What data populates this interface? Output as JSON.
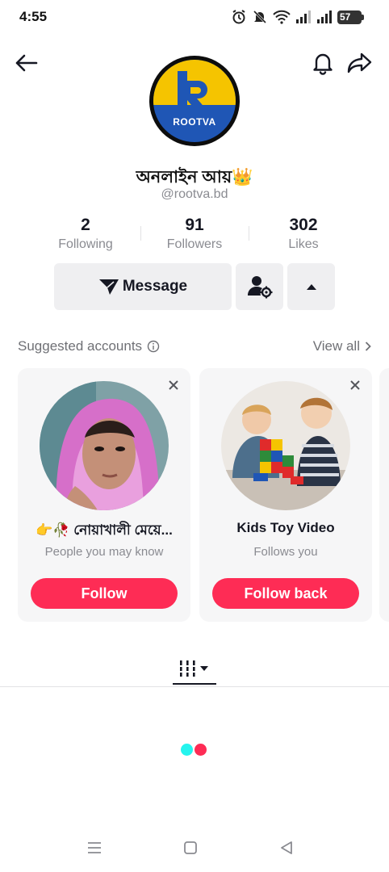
{
  "status_bar": {
    "time": "4:55",
    "battery": "57",
    "icons": [
      "alarm-icon",
      "mute-icon",
      "wifi-icon",
      "signal-icon",
      "signal-icon",
      "battery-icon"
    ]
  },
  "nav": {
    "back_icon": "arrow-left-icon",
    "bell_icon": "bell-icon",
    "share_icon": "share-icon"
  },
  "profile": {
    "logo_text": "ROOTVA",
    "name": "অনলাইন আয়👑",
    "handle": "@rootva.bd",
    "brand_colors": {
      "yellow": "#f5c400",
      "blue": "#1f56b5"
    }
  },
  "stats": [
    {
      "value": "2",
      "label": "Following"
    },
    {
      "value": "91",
      "label": "Followers"
    },
    {
      "value": "302",
      "label": "Likes"
    }
  ],
  "actions": {
    "message_label": "Message",
    "message_icon": "send-icon",
    "add_friend_icon": "user-settings-icon",
    "toggle_icon": "caret-up-icon"
  },
  "suggested": {
    "title": "Suggested accounts",
    "view_all": "View all",
    "cards": [
      {
        "name": "👉🥀 নোয়াখালী মেয়ে...",
        "subtitle": "People you may know",
        "button": "Follow"
      },
      {
        "name": "Kids Toy Video",
        "subtitle": "Follows you",
        "button": "Follow back"
      }
    ]
  },
  "tabs": {
    "videos_icon": "grid-icon"
  },
  "loader_colors": {
    "left": "#25f4ee",
    "right": "#fe2c55"
  },
  "accent_color": "#fe2c55",
  "system_nav": [
    "menu-icon",
    "home-square-icon",
    "back-triangle-icon"
  ]
}
